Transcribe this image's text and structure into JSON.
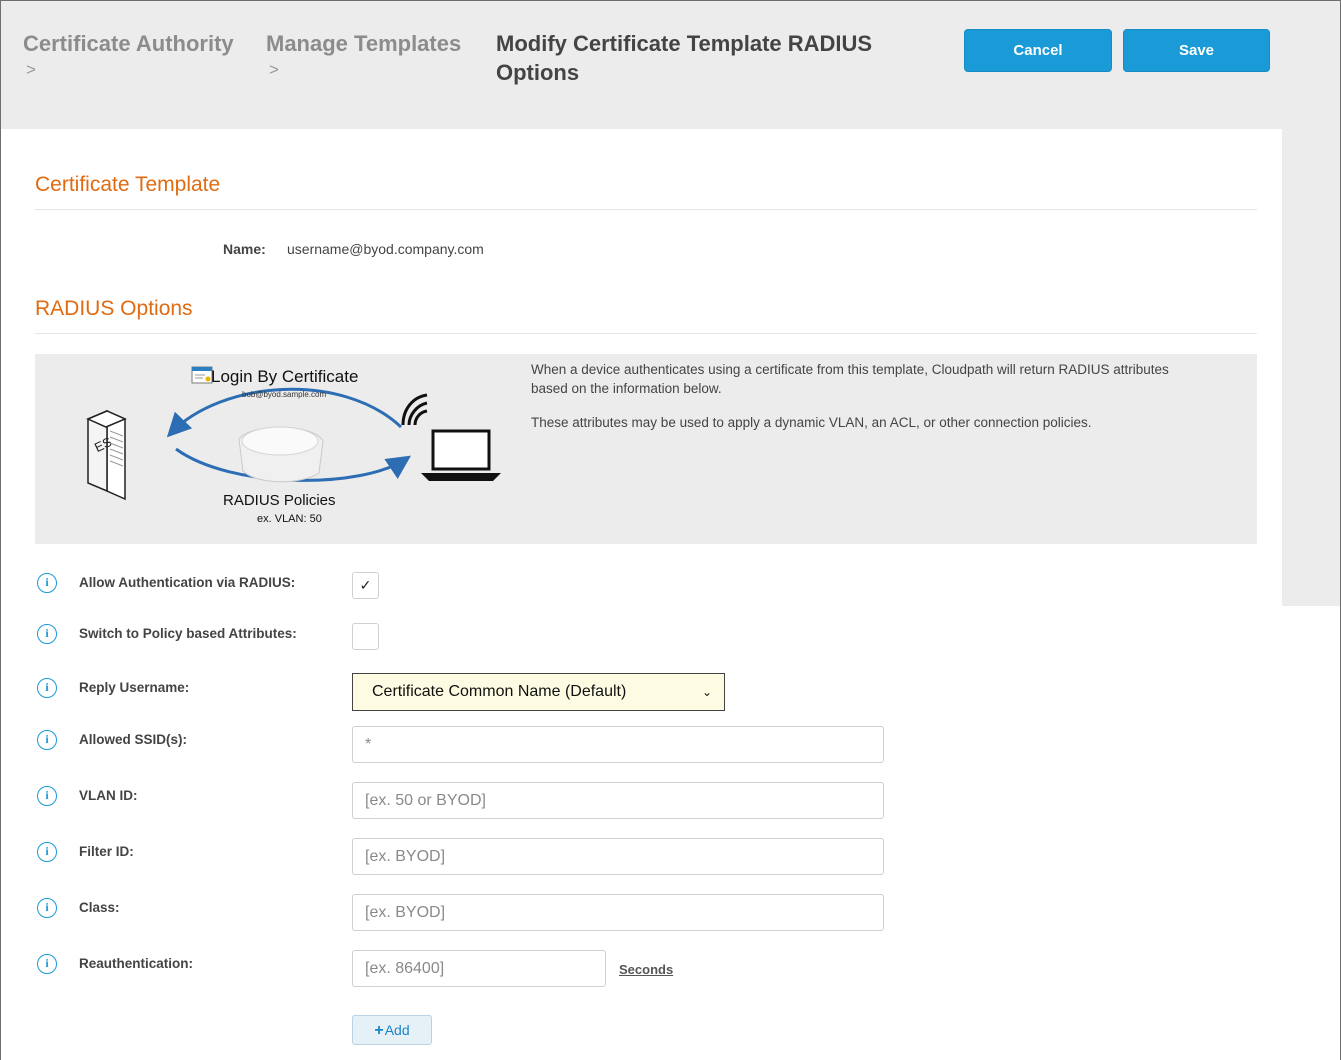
{
  "breadcrumb": {
    "items": [
      {
        "label": "Certificate Authority",
        "sep": ">"
      },
      {
        "label": "Manage Templates",
        "sep": ">"
      }
    ],
    "current": "Modify Certificate Template RADIUS Options"
  },
  "actions": {
    "cancel_label": "Cancel",
    "save_label": "Save"
  },
  "colors": {
    "accent": "#1a9ad6",
    "section_title": "#e06b12",
    "select_bg": "#fdfbe1"
  },
  "certificate_template": {
    "title": "Certificate Template",
    "name_label": "Name:",
    "name_value": "username@byod.company.com"
  },
  "radius": {
    "title": "RADIUS Options",
    "diagram": {
      "title": "Login By Certificate",
      "subtitle": "bob@byod.sample.com",
      "server_label": "ES",
      "policies": "RADIUS Policies",
      "vlan_example": "ex. VLAN: 50"
    },
    "description": [
      "When a device authenticates using a certificate from this template, Cloudpath will return RADIUS attributes based on the information below.",
      "These attributes may be used to apply a dynamic VLAN, an ACL, or other connection policies."
    ]
  },
  "form": {
    "info_icon": "i",
    "allow_auth": {
      "label": "Allow Authentication via RADIUS:",
      "checked_mark": "✓"
    },
    "policy_attrs": {
      "label": "Switch to Policy based Attributes:",
      "checked_mark": ""
    },
    "reply_username": {
      "label": "Reply Username:",
      "value": "Certificate Common Name (Default)",
      "caret": "⌄"
    },
    "allowed_ssids": {
      "label": "Allowed SSID(s):",
      "value": "*"
    },
    "vlan_id": {
      "label": "VLAN ID:",
      "placeholder": "[ex. 50 or BYOD]"
    },
    "filter_id": {
      "label": "Filter ID:",
      "placeholder": "[ex. BYOD]"
    },
    "class": {
      "label": "Class:",
      "placeholder": "[ex. BYOD]"
    },
    "reauth": {
      "label": "Reauthentication:",
      "placeholder": "[ex. 86400]",
      "unit": "Seconds"
    },
    "add_label": "Add"
  }
}
